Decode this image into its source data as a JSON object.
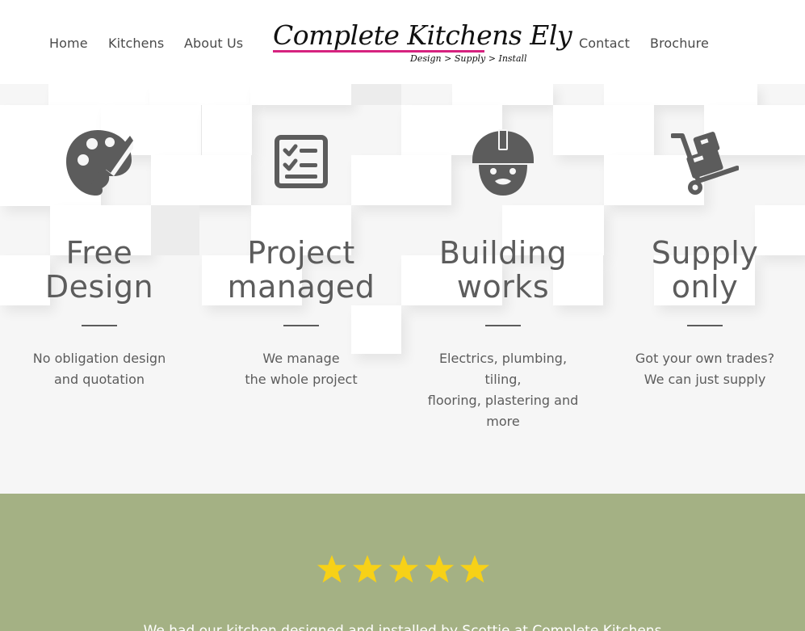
{
  "header": {
    "nav_left": [
      "Home",
      "Kitchens",
      "About Us"
    ],
    "nav_right": [
      "Contact",
      "Brochure"
    ],
    "logo": {
      "name": "Complete Kitchens Ely",
      "tagline": "Design > Supply > Install"
    }
  },
  "services": [
    {
      "icon": "palette-brush-icon",
      "title_line1": "Free",
      "title_line2": "Design",
      "description": "No obligation design\nand quotation"
    },
    {
      "icon": "checklist-icon",
      "title_line1": "Project",
      "title_line2": "managed",
      "description": "We manage\nthe whole project"
    },
    {
      "icon": "builder-helmet-icon",
      "title_line1": "Building",
      "title_line2": "works",
      "description": "Electrics, plumbing,\ntiling,\nflooring, plastering and\nmore"
    },
    {
      "icon": "hand-truck-icon",
      "title_line1": "Supply",
      "title_line2": "only",
      "description": "Got your own trades?\nWe can just supply"
    }
  ],
  "reviews": {
    "rating": 5,
    "max_rating": 5,
    "text": "We had our kitchen designed and installed by Scottie at Complete Kitchens"
  },
  "colors": {
    "accent_pink": "#d6227f",
    "review_band": "#a4b184",
    "star": "#f7d117",
    "icon_gray": "#5c5c5c"
  }
}
